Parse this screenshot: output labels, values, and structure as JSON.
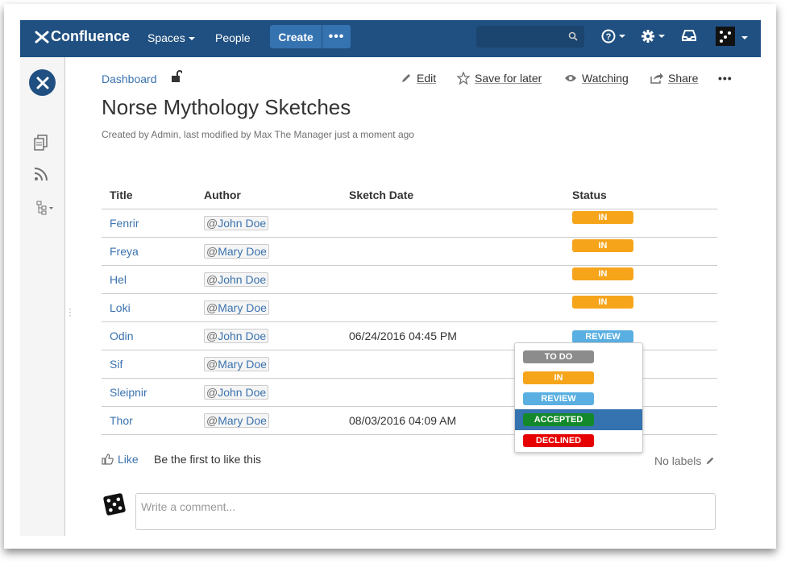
{
  "nav": {
    "logo": "Confluence",
    "spaces": "Spaces",
    "people": "People",
    "create": "Create",
    "more": "•••",
    "search_placeholder": "",
    "colors": {
      "bar": "#205081",
      "button": "#3572b0"
    }
  },
  "breadcrumb": "Dashboard",
  "actions": {
    "edit": "Edit",
    "save_for_later": "Save for later",
    "watching": "Watching",
    "share": "Share",
    "more": "•••"
  },
  "page": {
    "title": "Norse Mythology Sketches",
    "byline": "Created by Admin, last modified by Max The Manager just a moment ago"
  },
  "table": {
    "headers": [
      "Title",
      "Author",
      "Sketch Date",
      "Status"
    ],
    "rows": [
      {
        "title": "Fenrir",
        "author": "John Doe",
        "date": "",
        "status": "IN PROGRESS"
      },
      {
        "title": "Freya",
        "author": "Mary Doe",
        "date": "",
        "status": "IN PROGRESS"
      },
      {
        "title": "Hel",
        "author": "John Doe",
        "date": "",
        "status": "IN PROGRESS"
      },
      {
        "title": "Loki",
        "author": "Mary Doe",
        "date": "",
        "status": "IN PROGRESS"
      },
      {
        "title": "Odin",
        "author": "John Doe",
        "date": "06/24/2016 04:45 PM",
        "status": "REVIEW"
      },
      {
        "title": "Sif",
        "author": "Mary Doe",
        "date": "",
        "status": ""
      },
      {
        "title": "Sleipnir",
        "author": "John Doe",
        "date": "",
        "status": ""
      },
      {
        "title": "Thor",
        "author": "Mary Doe",
        "date": "08/03/2016 04:09 AM",
        "status": ""
      }
    ]
  },
  "status_options": [
    {
      "label": "TO DO",
      "color": "#8c8c8c"
    },
    {
      "label": "IN PROGRESS",
      "color": "#f6a51b"
    },
    {
      "label": "REVIEW",
      "color": "#59afe1"
    },
    {
      "label": "ACCEPTED",
      "color": "#14892c"
    },
    {
      "label": "DECLINED",
      "color": "#e60000"
    }
  ],
  "status_colors": {
    "IN PROGRESS": "#f6a51b",
    "REVIEW": "#59afe1"
  },
  "footer": {
    "like": "Like",
    "first_like": "Be the first to like this",
    "no_labels": "No labels",
    "comment_placeholder": "Write a comment..."
  }
}
